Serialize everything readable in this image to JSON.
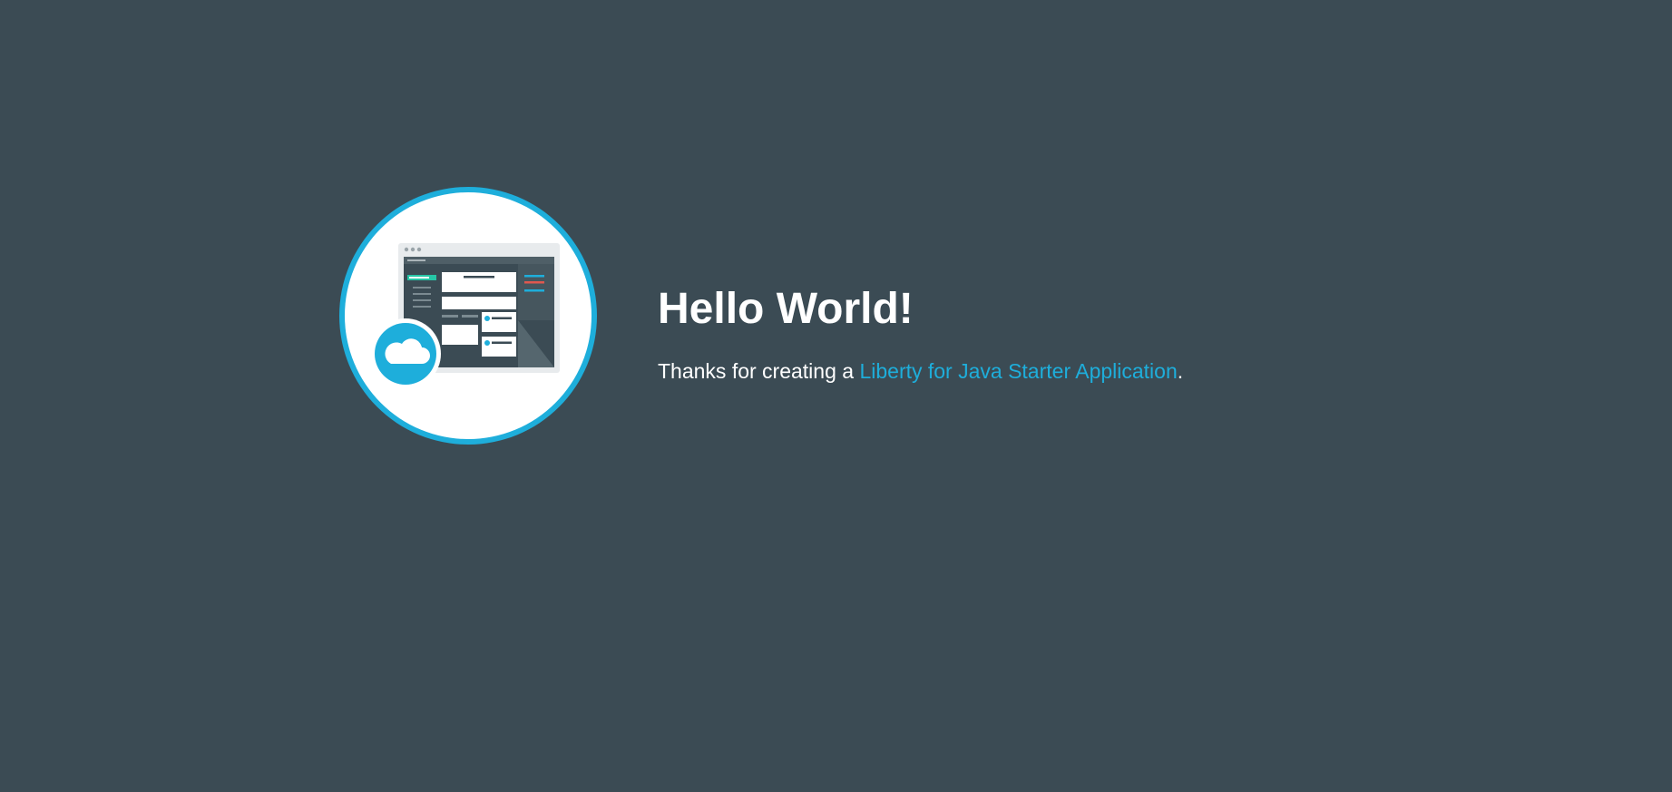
{
  "hero": {
    "icon": "cloud-app-window-illustration",
    "title": "Hello World!",
    "message_prefix": "Thanks for creating a ",
    "link_label": "Liberty for Java Starter Application",
    "message_suffix": "."
  },
  "colors": {
    "background": "#3b4b54",
    "accent": "#1eaedb",
    "heading": "#ffffff",
    "text": "#ffffff"
  }
}
